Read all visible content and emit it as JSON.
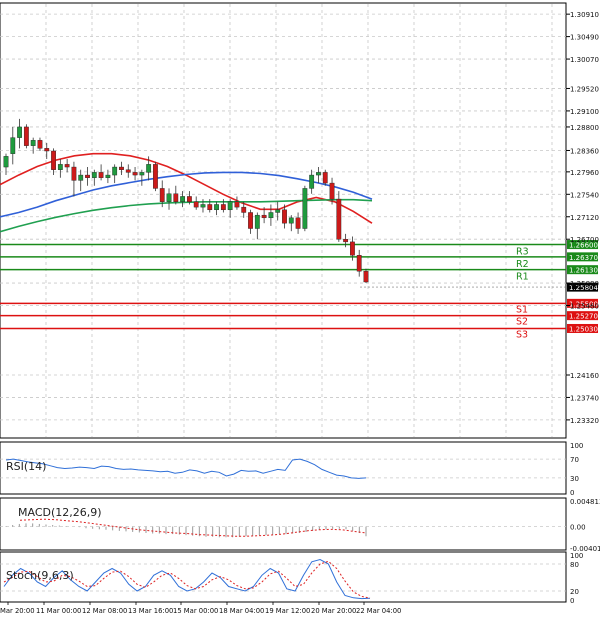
{
  "chart_data": [
    {
      "type": "candlestick",
      "ylim": [
        1.23,
        1.311
      ],
      "y_ticks": [
        "1.30910",
        "1.30490",
        "1.30070",
        "1.29520",
        "1.29100",
        "1.28800",
        "1.28360",
        "1.27960",
        "1.27540",
        "1.27120",
        "1.26700",
        "1.25880",
        "1.25460",
        "1.24160",
        "1.23740",
        "1.23320"
      ],
      "x_ticks": [
        "Mar 20:00",
        "11 Mar 00:00",
        "12 Mar 08:00",
        "13 Mar 16:00",
        "15 Mar 00:00",
        "18 Mar 04:00",
        "19 Mar 12:00",
        "20 Mar 20:00",
        "22 Mar 04:00"
      ],
      "candles": [
        [
          1.2805,
          1.283,
          1.279,
          1.2825
        ],
        [
          1.283,
          1.288,
          1.281,
          1.286
        ],
        [
          1.286,
          1.2895,
          1.284,
          1.288
        ],
        [
          1.288,
          1.2885,
          1.284,
          1.2845
        ],
        [
          1.2845,
          1.286,
          1.283,
          1.2855
        ],
        [
          1.2855,
          1.286,
          1.2835,
          1.284
        ],
        [
          1.284,
          1.285,
          1.282,
          1.2835
        ],
        [
          1.2835,
          1.284,
          1.279,
          1.28
        ],
        [
          1.28,
          1.282,
          1.2785,
          1.281
        ],
        [
          1.281,
          1.282,
          1.2795,
          1.2805
        ],
        [
          1.2805,
          1.2815,
          1.275,
          1.278
        ],
        [
          1.278,
          1.28,
          1.276,
          1.279
        ],
        [
          1.279,
          1.2805,
          1.277,
          1.2785
        ],
        [
          1.2785,
          1.28,
          1.277,
          1.2795
        ],
        [
          1.2795,
          1.281,
          1.278,
          1.2785
        ],
        [
          1.2785,
          1.28,
          1.2775,
          1.279
        ],
        [
          1.279,
          1.281,
          1.2775,
          1.2805
        ],
        [
          1.2805,
          1.2815,
          1.279,
          1.28
        ],
        [
          1.28,
          1.281,
          1.2785,
          1.2795
        ],
        [
          1.2795,
          1.2805,
          1.278,
          1.279
        ],
        [
          1.279,
          1.28,
          1.277,
          1.2795
        ],
        [
          1.2795,
          1.2825,
          1.278,
          1.281
        ],
        [
          1.281,
          1.2815,
          1.276,
          1.2765
        ],
        [
          1.2765,
          1.278,
          1.273,
          1.274
        ],
        [
          1.274,
          1.2765,
          1.2725,
          1.2755
        ],
        [
          1.2755,
          1.277,
          1.2735,
          1.274
        ],
        [
          1.274,
          1.276,
          1.273,
          1.275
        ],
        [
          1.275,
          1.276,
          1.2735,
          1.274
        ],
        [
          1.274,
          1.275,
          1.2725,
          1.273
        ],
        [
          1.273,
          1.2745,
          1.272,
          1.2735
        ],
        [
          1.2735,
          1.2745,
          1.272,
          1.2725
        ],
        [
          1.2725,
          1.274,
          1.2715,
          1.2735
        ],
        [
          1.2735,
          1.2745,
          1.272,
          1.2725
        ],
        [
          1.2725,
          1.2745,
          1.271,
          1.274
        ],
        [
          1.274,
          1.275,
          1.2725,
          1.273
        ],
        [
          1.273,
          1.274,
          1.271,
          1.272
        ],
        [
          1.272,
          1.2725,
          1.268,
          1.269
        ],
        [
          1.269,
          1.272,
          1.267,
          1.2715
        ],
        [
          1.2715,
          1.273,
          1.27,
          1.271
        ],
        [
          1.271,
          1.2735,
          1.2695,
          1.272
        ],
        [
          1.272,
          1.274,
          1.2705,
          1.2725
        ],
        [
          1.2725,
          1.2735,
          1.269,
          1.27
        ],
        [
          1.27,
          1.2715,
          1.2685,
          1.271
        ],
        [
          1.271,
          1.272,
          1.268,
          1.269
        ],
        [
          1.269,
          1.277,
          1.2685,
          1.2765
        ],
        [
          1.2765,
          1.28,
          1.2755,
          1.279
        ],
        [
          1.279,
          1.2805,
          1.2775,
          1.2795
        ],
        [
          1.2795,
          1.28,
          1.277,
          1.2775
        ],
        [
          1.2775,
          1.2785,
          1.2735,
          1.2745
        ],
        [
          1.2745,
          1.276,
          1.2665,
          1.267
        ],
        [
          1.267,
          1.268,
          1.2655,
          1.2665
        ],
        [
          1.2665,
          1.2675,
          1.263,
          1.264
        ],
        [
          1.264,
          1.265,
          1.26,
          1.261
        ],
        [
          1.261,
          1.2615,
          1.2588,
          1.259
        ]
      ],
      "overlays": [
        {
          "color": "#e02020",
          "values": [
            1.2772,
            1.279,
            1.2806,
            1.2818,
            1.2826,
            1.283,
            1.283,
            1.2826,
            1.2818,
            1.2806,
            1.279,
            1.2772,
            1.2754,
            1.2738,
            1.2726,
            1.2726,
            1.274,
            1.2748,
            1.274,
            1.2722,
            1.27
          ]
        },
        {
          "color": "#3060d8",
          "values": [
            1.2712,
            1.272,
            1.273,
            1.2742,
            1.2752,
            1.2762,
            1.277,
            1.2776,
            1.2782,
            1.2787,
            1.2791,
            1.2794,
            1.2795,
            1.2795,
            1.2793,
            1.2789,
            1.2783,
            1.2776,
            1.2768,
            1.2758,
            1.2745
          ]
        },
        {
          "color": "#20a050",
          "values": [
            1.2684,
            1.2694,
            1.2703,
            1.2711,
            1.2718,
            1.2724,
            1.2729,
            1.2733,
            1.2736,
            1.2738,
            1.2739,
            1.274,
            1.274,
            1.274,
            1.274,
            1.2741,
            1.2742,
            1.2743,
            1.2744,
            1.2744,
            1.2742
          ]
        }
      ],
      "levels": [
        {
          "name": "R3",
          "value": "1.26600",
          "color": "#1a8a1a"
        },
        {
          "name": "R2",
          "value": "1.26370",
          "color": "#1a8a1a"
        },
        {
          "name": "R1",
          "value": "1.26130",
          "color": "#1a8a1a"
        },
        {
          "name": "S1",
          "value": "1.25500",
          "color": "#dd1111"
        },
        {
          "name": "S2",
          "value": "1.25270",
          "color": "#dd1111"
        },
        {
          "name": "S3",
          "value": "1.25030",
          "color": "#dd1111"
        }
      ],
      "current_price": "1.25804"
    },
    {
      "type": "line",
      "title": "RSI(14)",
      "ylim": [
        0,
        100
      ],
      "y_ticks": [
        "100",
        "70",
        "30",
        "0"
      ],
      "series": [
        {
          "color": "#3070d8",
          "values": [
            68,
            70,
            67,
            64,
            62,
            60,
            56,
            52,
            50,
            51,
            53,
            52,
            50,
            55,
            54,
            50,
            48,
            49,
            47,
            46,
            45,
            43,
            44,
            40,
            42,
            47,
            45,
            40,
            44,
            42,
            34,
            38,
            46,
            44,
            45,
            40,
            44,
            48,
            46,
            68,
            70,
            65,
            58,
            48,
            42,
            36,
            34,
            30,
            29,
            30
          ]
        }
      ]
    },
    {
      "type": "bar",
      "title": "MACD(12,26,9)",
      "ylim": [
        -0.004017,
        0.004813
      ],
      "y_ticks": [
        "0.004813",
        "0.00",
        "-0.004017"
      ],
      "values": [
        0.0001,
        0.0003,
        0.0005,
        0.0006,
        0.0006,
        0.0005,
        0.0004,
        0.0003,
        0.0002,
        0.0001,
        0.0,
        -0.0001,
        -0.0003,
        -0.0004,
        -0.0005,
        -0.0006,
        -0.0007,
        -0.0008,
        -0.0009,
        -0.001,
        -0.0011,
        -0.0012,
        -0.0013,
        -0.0013,
        -0.0014,
        -0.0014,
        -0.0015,
        -0.0016,
        -0.0017,
        -0.0018,
        -0.0019,
        -0.0019,
        -0.002,
        -0.002,
        -0.002,
        -0.0019,
        -0.0018,
        -0.0017,
        -0.0016,
        -0.0016,
        -0.0015,
        -0.0014,
        -0.0014,
        -0.0013,
        -0.0012,
        -0.001,
        -0.0008,
        -0.0006,
        -0.0005,
        -0.0004,
        -0.0004,
        -0.0005,
        -0.0008,
        -0.0012,
        -0.0018
      ],
      "signal": [
        0.0012,
        0.0013,
        0.0014,
        0.0013,
        0.0011,
        0.0009,
        0.0006,
        0.0003,
        0.0,
        -0.0003,
        -0.0006,
        -0.0008,
        -0.001,
        -0.0012,
        -0.0013,
        -0.0015,
        -0.0016,
        -0.0017,
        -0.0018,
        -0.0018,
        -0.0017,
        -0.0016,
        -0.0014,
        -0.0011,
        -0.0008,
        -0.0006,
        -0.0005,
        -0.0006,
        -0.0009,
        -0.0012
      ]
    },
    {
      "type": "line",
      "title": "Stoch(9,6,3)",
      "ylim": [
        0,
        100
      ],
      "y_ticks": [
        "100",
        "80",
        "20",
        "0"
      ],
      "series": [
        {
          "color": "#3070d8",
          "values": [
            30,
            55,
            70,
            60,
            40,
            30,
            50,
            65,
            45,
            30,
            20,
            40,
            60,
            70,
            60,
            35,
            20,
            30,
            55,
            65,
            55,
            30,
            20,
            25,
            40,
            60,
            50,
            30,
            25,
            20,
            30,
            55,
            70,
            60,
            25,
            20,
            55,
            85,
            90,
            80,
            40,
            10,
            5,
            3,
            4
          ]
        },
        {
          "color": "#dd2222",
          "dashed": true,
          "values": [
            40,
            50,
            62,
            64,
            52,
            40,
            42,
            55,
            52,
            42,
            30,
            32,
            48,
            62,
            64,
            52,
            35,
            28,
            40,
            55,
            60,
            48,
            32,
            25,
            30,
            45,
            52,
            45,
            32,
            25,
            27,
            40,
            58,
            64,
            48,
            30,
            35,
            60,
            80,
            86,
            70,
            42,
            18,
            8,
            4
          ]
        }
      ]
    }
  ]
}
